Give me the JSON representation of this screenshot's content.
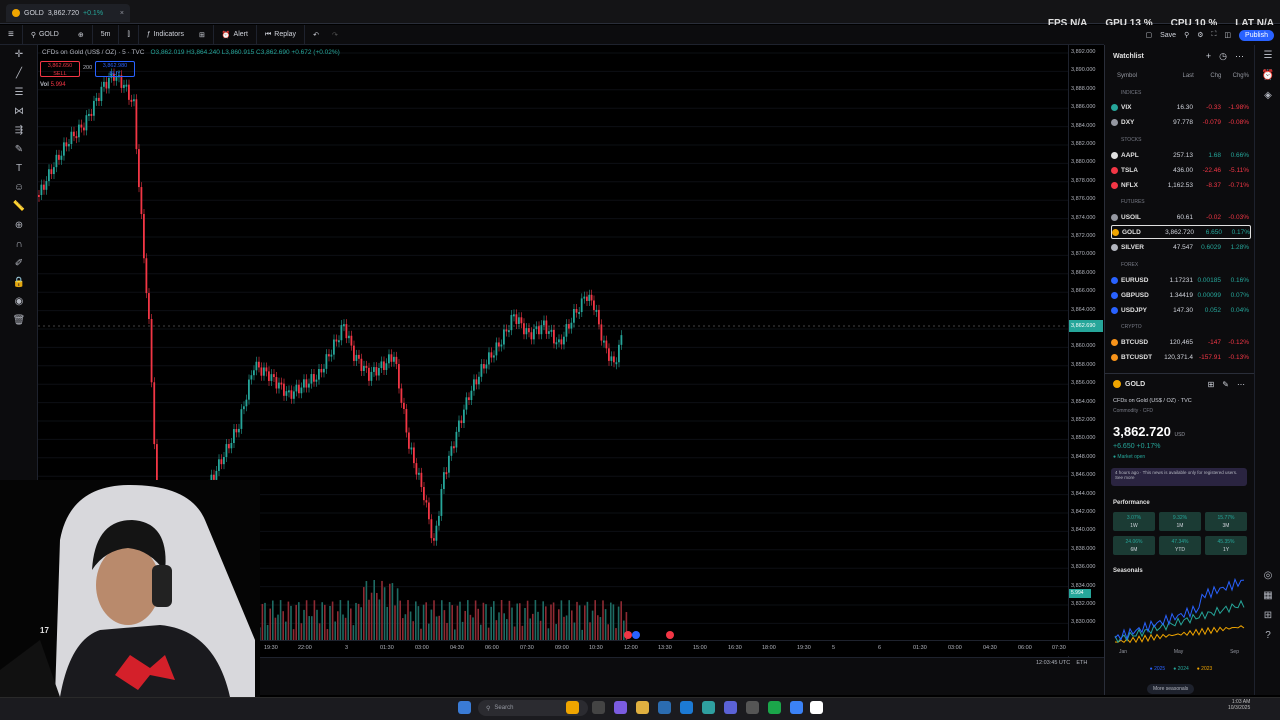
{
  "tab": {
    "symbol": "GOLD",
    "price": "3,862.720",
    "change": "+0.1%",
    "close": "×"
  },
  "perf": {
    "fps": "FPS N/A",
    "gpu": "GPU 13 %",
    "cpu": "CPU 10 %",
    "lat": "LAT N/A"
  },
  "toolbar": {
    "symbol": "GOLD",
    "interval": "5m",
    "indicators": "Indicators",
    "alert": "Alert",
    "replay": "Replay"
  },
  "right_tools": {
    "save": "Save",
    "publish": "Publish"
  },
  "legend": {
    "title": "CFDs on Gold (US$ / OZ) · 5 · TVC",
    "ohlc": "O3,862.019 H3,864.240 L3,860.915 C3,862.690 +0.672 (+0.02%)"
  },
  "order": {
    "sell_price": "3,862.650",
    "sell_label": "SELL",
    "spread": "200",
    "buy_price": "3,862.980",
    "buy_label": "BUY"
  },
  "vol": {
    "label": "Vol",
    "value": "5.994"
  },
  "price_axis": [
    "3,892.000",
    "3,890.000",
    "3,888.000",
    "3,886.000",
    "3,884.000",
    "3,882.000",
    "3,880.000",
    "3,878.000",
    "3,876.000",
    "3,874.000",
    "3,872.000",
    "3,870.000",
    "3,868.000",
    "3,866.000",
    "3,864.000",
    "3,862.000",
    "3,860.000",
    "3,858.000",
    "3,856.000",
    "3,854.000",
    "3,852.000",
    "3,850.000",
    "3,848.000",
    "3,846.000",
    "3,844.000",
    "3,842.000",
    "3,840.000",
    "3,838.000",
    "3,836.000",
    "3,834.000",
    "3,832.000",
    "3,830.000"
  ],
  "last_price_tag": "3,862.690",
  "vol_tag": "5.994",
  "time_axis": [
    "19:30",
    "22:00",
    "3",
    "01:30",
    "03:00",
    "04:30",
    "06:00",
    "07:30",
    "09:00",
    "10:30",
    "12:00",
    "13:30",
    "15:00",
    "16:30",
    "18:00",
    "19:30",
    "5",
    "6",
    "01:30",
    "03:00",
    "04:30",
    "06:00",
    "07:30"
  ],
  "utc": "12:03:45 UTC",
  "session": "ETH",
  "watchlist": {
    "title": "Watchlist",
    "cols": [
      "Symbol",
      "Last",
      "Chg",
      "Chg%"
    ],
    "sections": {
      "indices": "INDICES",
      "stocks": "STOCKS",
      "futures": "FUTURES",
      "forex": "FOREX",
      "crypto": "CRYPTO"
    },
    "rows": [
      {
        "sym": "VIX",
        "last": "16.30",
        "chg": "-0.33",
        "pct": "-1.98%",
        "color": "#26a69a",
        "dir": "dn"
      },
      {
        "sym": "DXY",
        "last": "97.778",
        "chg": "-0.079",
        "pct": "-0.08%",
        "color": "#9598a1",
        "dir": "dn"
      },
      {
        "sym": "AAPL",
        "last": "257.13",
        "chg": "1.68",
        "pct": "0.66%",
        "color": "#e0e0e0",
        "dir": "up"
      },
      {
        "sym": "TSLA",
        "last": "436.00",
        "chg": "-22.46",
        "pct": "-5.11%",
        "color": "#f23645",
        "dir": "dn"
      },
      {
        "sym": "NFLX",
        "last": "1,162.53",
        "chg": "-8.37",
        "pct": "-0.71%",
        "color": "#f23645",
        "dir": "dn"
      },
      {
        "sym": "USOIL",
        "last": "60.61",
        "chg": "-0.02",
        "pct": "-0.03%",
        "color": "#9598a1",
        "dir": "dn"
      },
      {
        "sym": "GOLD",
        "last": "3,862.720",
        "chg": "6.650",
        "pct": "0.17%",
        "color": "#f0a500",
        "dir": "up"
      },
      {
        "sym": "SILVER",
        "last": "47.547",
        "chg": "0.6029",
        "pct": "1.28%",
        "color": "#b2b5be",
        "dir": "up"
      },
      {
        "sym": "EURUSD",
        "last": "1.17231",
        "chg": "0.00185",
        "pct": "0.16%",
        "color": "#2962ff",
        "dir": "up"
      },
      {
        "sym": "GBPUSD",
        "last": "1.34419",
        "chg": "0.00099",
        "pct": "0.07%",
        "color": "#2962ff",
        "dir": "up"
      },
      {
        "sym": "USDJPY",
        "last": "147.30",
        "chg": "0.052",
        "pct": "0.04%",
        "color": "#2962ff",
        "dir": "up"
      },
      {
        "sym": "BTCUSD",
        "last": "120,465",
        "chg": "-147",
        "pct": "-0.12%",
        "color": "#f7931a",
        "dir": "dn"
      },
      {
        "sym": "BTCUSDT",
        "last": "120,371.4",
        "chg": "-157.91",
        "pct": "-0.13%",
        "color": "#f7931a",
        "dir": "dn"
      }
    ]
  },
  "detail": {
    "symbol": "GOLD",
    "name": "CFDs on Gold (US$ / OZ) · TVC",
    "type": "Commodity · CFD",
    "price": "3,862.720",
    "currency": "USD",
    "change": "+6.650 +0.17%",
    "market": "● Market open",
    "news": "4 hours ago · This news is available only for registered users. See more",
    "performance_title": "Performance",
    "performance": [
      {
        "v": "3.07%",
        "l": "1W"
      },
      {
        "v": "9.32%",
        "l": "1M"
      },
      {
        "v": "15.77%",
        "l": "3M"
      },
      {
        "v": "24.06%",
        "l": "6M"
      },
      {
        "v": "47.34%",
        "l": "YTD"
      },
      {
        "v": "45.35%",
        "l": "1Y"
      }
    ],
    "seasonals_title": "Seasonals",
    "seasonals_x": [
      "Jan",
      "May",
      "Sep"
    ],
    "seasonals_legend": [
      "● 2025",
      "● 2024",
      "● 2023"
    ],
    "more": "More seasonals"
  },
  "taskbar": {
    "search": "Search",
    "time": "1:03 AM",
    "date": "10/3/2025"
  },
  "colors": {
    "up": "#26a69a",
    "down": "#f23645",
    "accent": "#2962ff"
  }
}
